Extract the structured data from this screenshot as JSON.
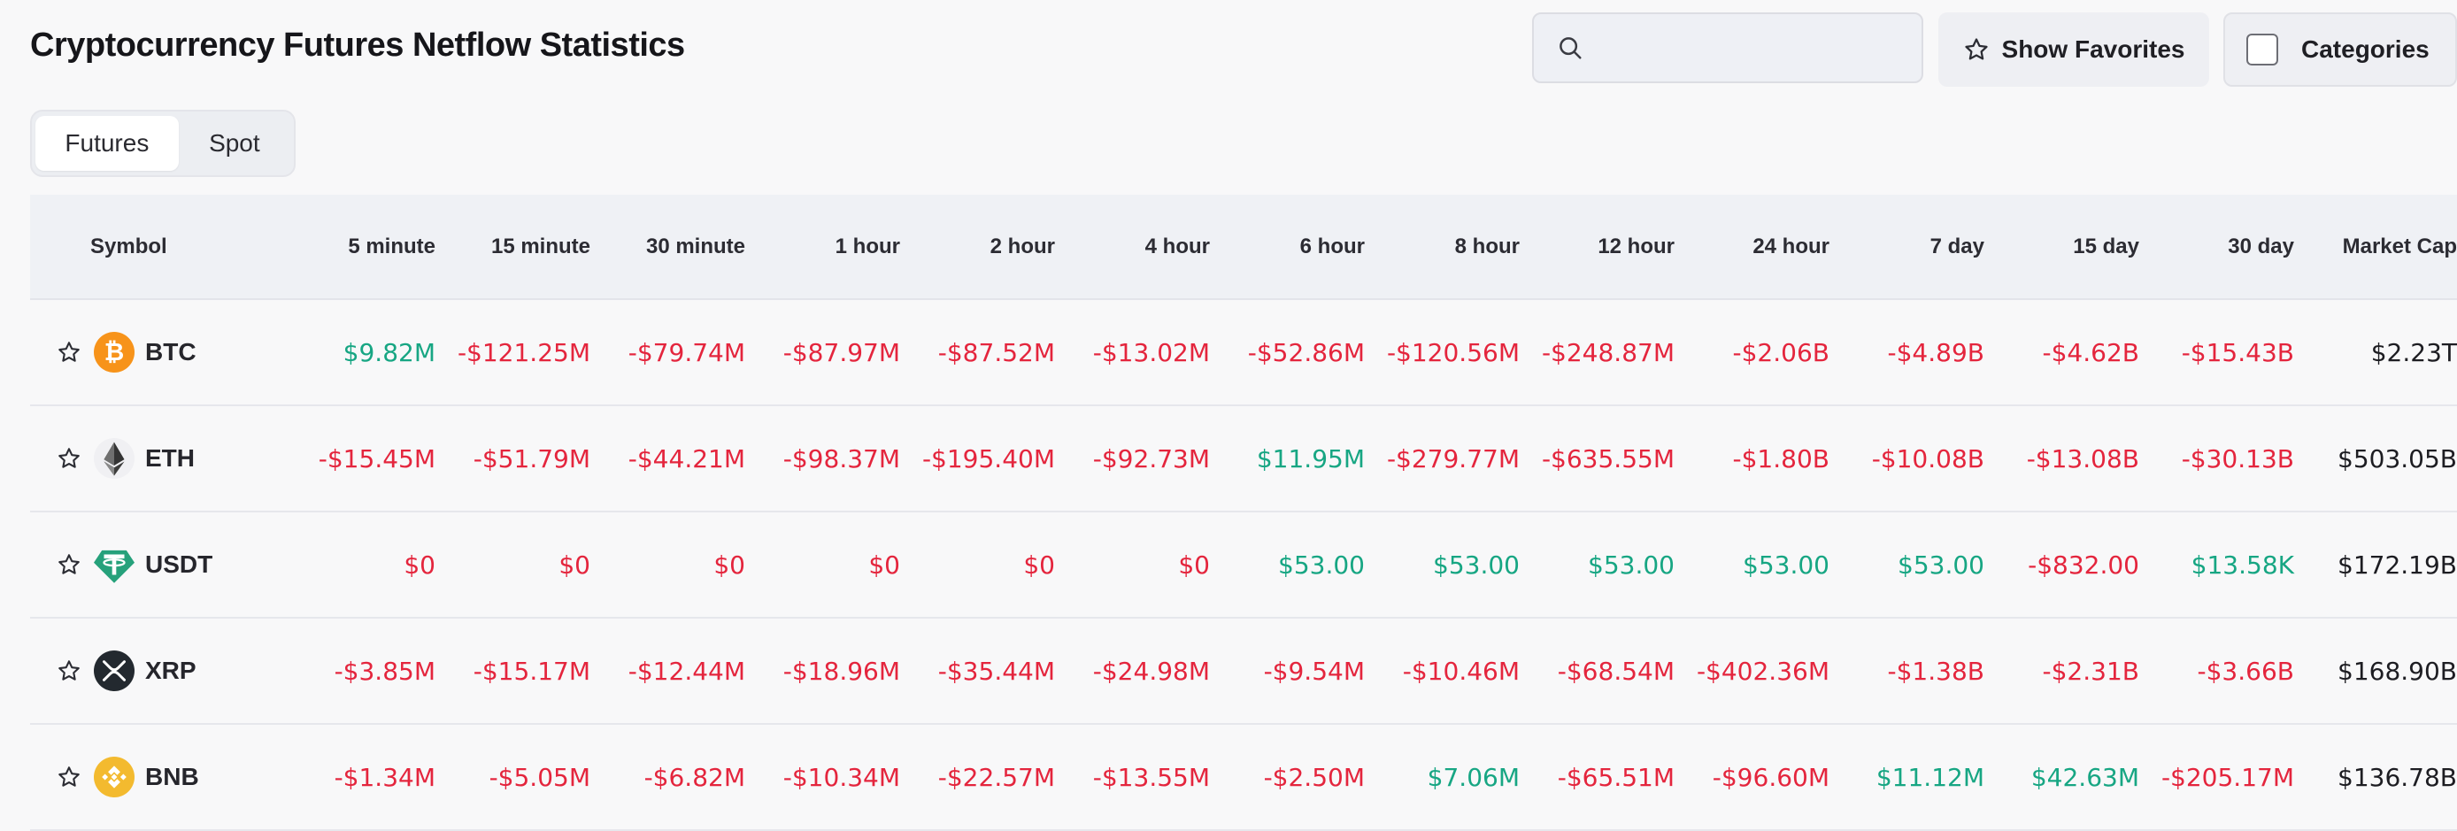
{
  "page": {
    "title": "Cryptocurrency Futures Netflow Statistics"
  },
  "search": {
    "placeholder": "",
    "value": ""
  },
  "buttons": {
    "show_favorites": "Show Favorites",
    "categories": "Categories"
  },
  "tabs": {
    "futures": "Futures",
    "spot": "Spot",
    "active": "Futures"
  },
  "colors": {
    "negative": "#e4253d",
    "positive": "#17a683"
  },
  "table": {
    "headers": {
      "symbol": "Symbol",
      "periods": [
        "5 minute",
        "15 minute",
        "30 minute",
        "1 hour",
        "2 hour",
        "4 hour",
        "6 hour",
        "8 hour",
        "12 hour",
        "24 hour",
        "7 day",
        "15 day",
        "30 day"
      ],
      "market_cap": "Market Cap"
    },
    "rows": [
      {
        "symbol": "BTC",
        "icon": "btc-icon",
        "values": [
          "$9.82M",
          "-$121.25M",
          "-$79.74M",
          "-$87.97M",
          "-$87.52M",
          "-$13.02M",
          "-$52.86M",
          "-$120.56M",
          "-$248.87M",
          "-$2.06B",
          "-$4.89B",
          "-$4.62B",
          "-$15.43B"
        ],
        "market_cap": "$2.23T"
      },
      {
        "symbol": "ETH",
        "icon": "eth-icon",
        "values": [
          "-$15.45M",
          "-$51.79M",
          "-$44.21M",
          "-$98.37M",
          "-$195.40M",
          "-$92.73M",
          "$11.95M",
          "-$279.77M",
          "-$635.55M",
          "-$1.80B",
          "-$10.08B",
          "-$13.08B",
          "-$30.13B"
        ],
        "market_cap": "$503.05B"
      },
      {
        "symbol": "USDT",
        "icon": "usdt-icon",
        "values": [
          "$0",
          "$0",
          "$0",
          "$0",
          "$0",
          "$0",
          "$53.00",
          "$53.00",
          "$53.00",
          "$53.00",
          "$53.00",
          "-$832.00",
          "$13.58K"
        ],
        "market_cap": "$172.19B"
      },
      {
        "symbol": "XRP",
        "icon": "xrp-icon",
        "values": [
          "-$3.85M",
          "-$15.17M",
          "-$12.44M",
          "-$18.96M",
          "-$35.44M",
          "-$24.98M",
          "-$9.54M",
          "-$10.46M",
          "-$68.54M",
          "-$402.36M",
          "-$1.38B",
          "-$2.31B",
          "-$3.66B"
        ],
        "market_cap": "$168.90B"
      },
      {
        "symbol": "BNB",
        "icon": "bnb-icon",
        "values": [
          "-$1.34M",
          "-$5.05M",
          "-$6.82M",
          "-$10.34M",
          "-$22.57M",
          "-$13.55M",
          "-$2.50M",
          "$7.06M",
          "-$65.51M",
          "-$96.60M",
          "$11.12M",
          "$42.63M",
          "-$205.17M"
        ],
        "market_cap": "$136.78B"
      }
    ],
    "value_colors": [
      [
        "pos",
        "neg",
        "neg",
        "neg",
        "neg",
        "neg",
        "neg",
        "neg",
        "neg",
        "neg",
        "neg",
        "neg",
        "neg"
      ],
      [
        "neg",
        "neg",
        "neg",
        "neg",
        "neg",
        "neg",
        "pos",
        "neg",
        "neg",
        "neg",
        "neg",
        "neg",
        "neg"
      ],
      [
        "neg",
        "neg",
        "neg",
        "neg",
        "neg",
        "neg",
        "pos",
        "pos",
        "pos",
        "pos",
        "pos",
        "neg",
        "pos"
      ],
      [
        "neg",
        "neg",
        "neg",
        "neg",
        "neg",
        "neg",
        "neg",
        "neg",
        "neg",
        "neg",
        "neg",
        "neg",
        "neg"
      ],
      [
        "neg",
        "neg",
        "neg",
        "neg",
        "neg",
        "neg",
        "neg",
        "pos",
        "neg",
        "neg",
        "pos",
        "pos",
        "neg"
      ]
    ]
  }
}
